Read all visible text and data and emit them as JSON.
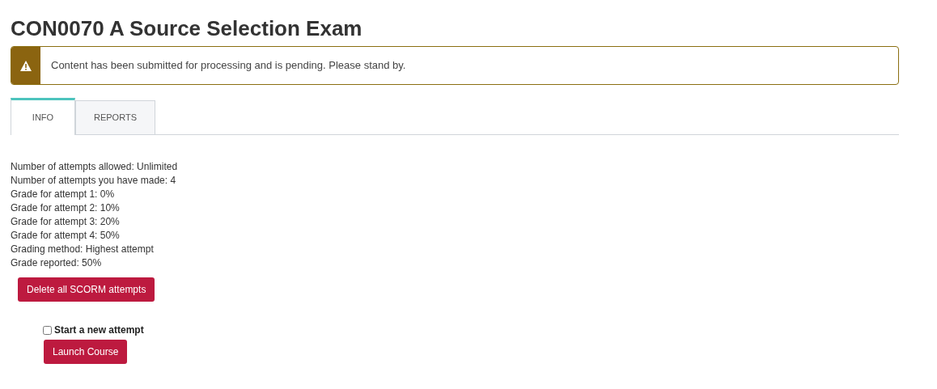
{
  "title": "CON0070 A Source Selection Exam",
  "alert": {
    "kind": "warning",
    "message": "Content has been submitted for processing and is pending. Please stand by."
  },
  "tabs": [
    {
      "label": "INFO",
      "selected": true
    },
    {
      "label": "REPORTS",
      "selected": false
    }
  ],
  "info_lines": [
    "Number of attempts allowed: Unlimited",
    "Number of attempts you have made: 4",
    "Grade for attempt 1: 0%",
    "Grade for attempt 2: 10%",
    "Grade for attempt 3: 20%",
    "Grade for attempt 4: 50%",
    "Grading method: Highest attempt",
    "Grade reported: 50%"
  ],
  "delete_button": "Delete all SCORM attempts",
  "new_attempt": {
    "label": "Start a new attempt",
    "checked": false
  },
  "launch_button": "Launch Course"
}
